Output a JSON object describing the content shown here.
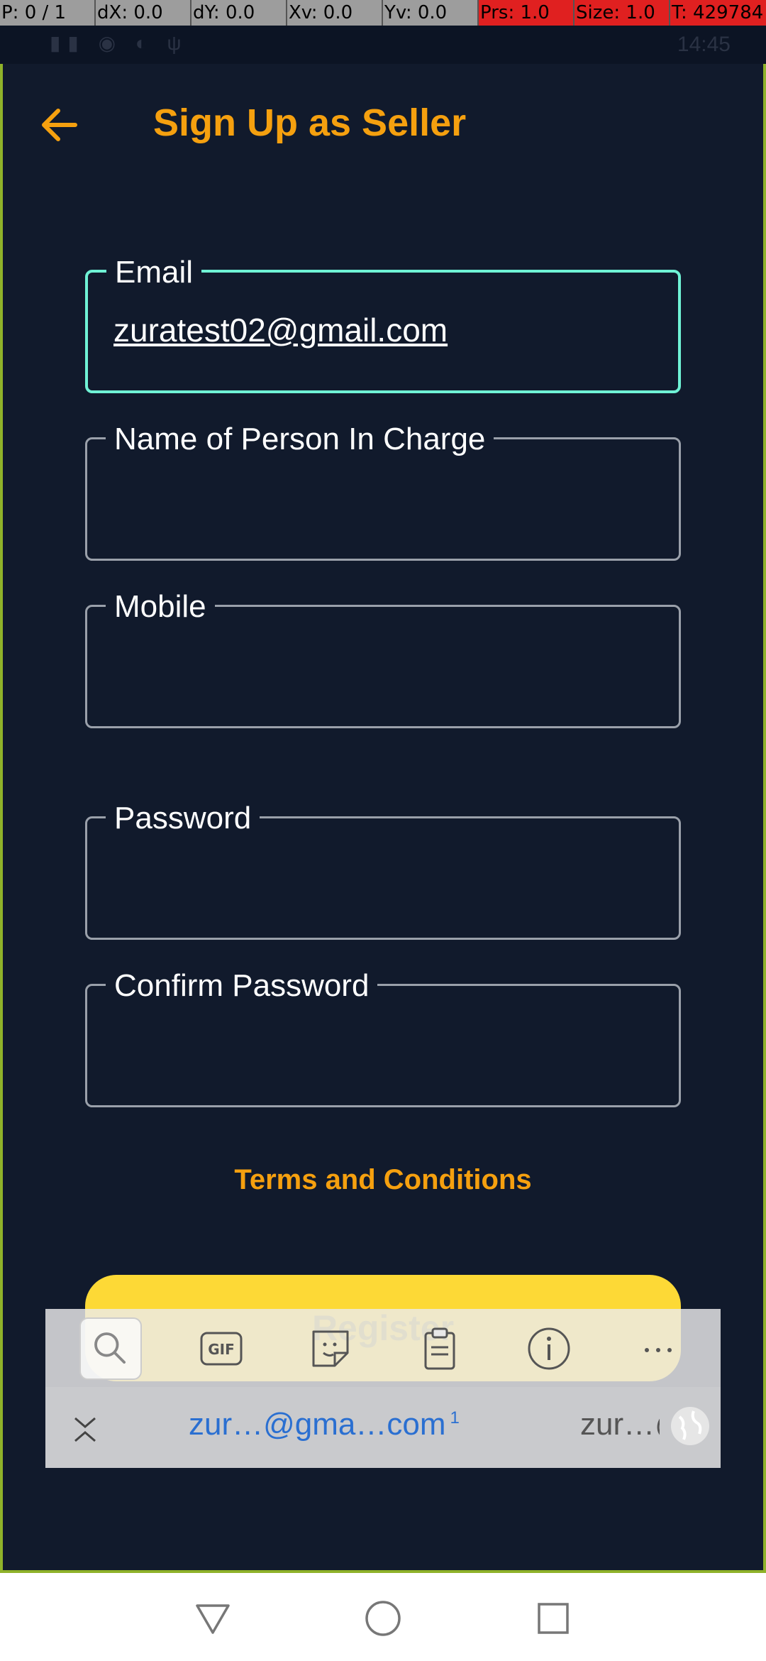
{
  "debug": {
    "pointer": "P: 0 / 1",
    "dx": "dX: 0.0",
    "dy": "dY: 0.0",
    "xv": "Xv: 0.0",
    "yv": "Yv: 0.0",
    "prs": "Prs: 1.0",
    "size": "Size: 1.0",
    "time": "T: 429784"
  },
  "status_bar": {
    "clock": "14:45"
  },
  "header": {
    "title": "Sign Up as Seller",
    "back_icon": "arrow-left-icon"
  },
  "form": {
    "email": {
      "label": "Email",
      "value": "zuratest02@gmail.com"
    },
    "person": {
      "label": "Name of Person In Charge",
      "value": ""
    },
    "mobile": {
      "label": "Mobile",
      "value": ""
    },
    "password": {
      "label": "Password",
      "value": ""
    },
    "confirm": {
      "label": "Confirm Password",
      "value": ""
    },
    "terms_link": "Terms and Conditions",
    "register_label": "Register"
  },
  "keyboard": {
    "tools": [
      "search-icon",
      "gif-icon",
      "sticker-icon",
      "clipboard-icon",
      "info-icon",
      "more-icon"
    ],
    "suggestion_primary": "zur…@gma…com",
    "suggestion_count": "1",
    "suggestion_secondary": "zur…@"
  },
  "colors": {
    "background": "#111a2c",
    "accent": "#f5a00f",
    "focus_border": "#6ff2d5",
    "register_button": "#fdd936"
  }
}
